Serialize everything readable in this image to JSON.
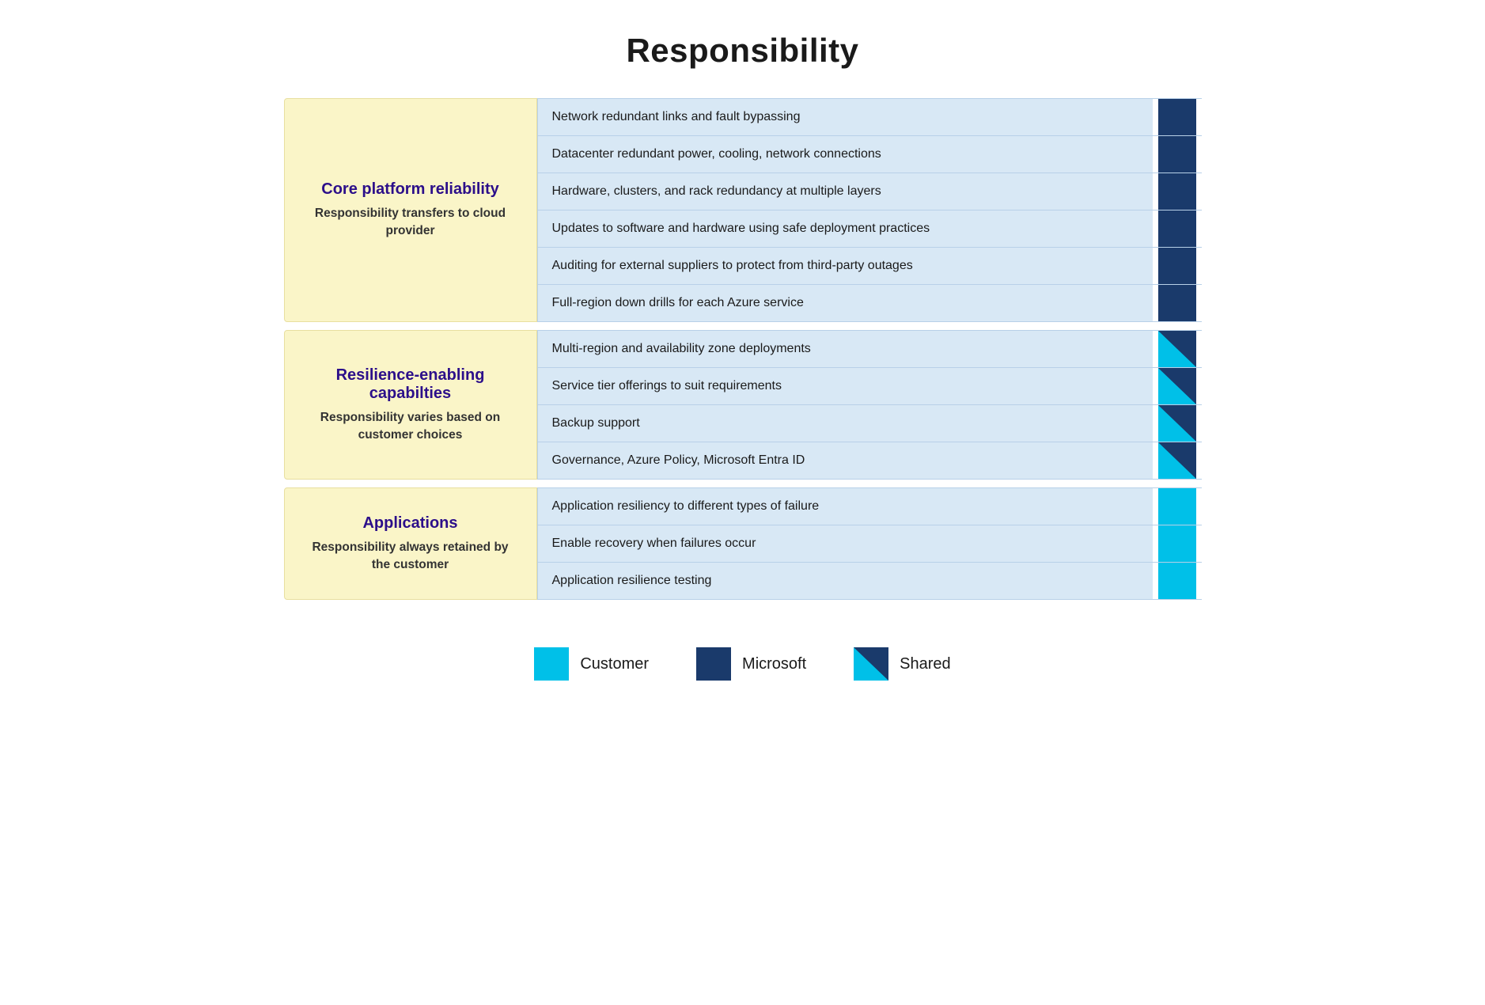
{
  "title": "Responsibility",
  "sections": [
    {
      "id": "core-platform",
      "title": "Core platform reliability",
      "subtitle": "Responsibility transfers\nto cloud provider",
      "items": [
        {
          "text": "Network redundant links and fault bypassing",
          "indicator": "microsoft"
        },
        {
          "text": "Datacenter redundant power, cooling, network connections",
          "indicator": "microsoft"
        },
        {
          "text": "Hardware, clusters, and rack redundancy at multiple layers",
          "indicator": "microsoft"
        },
        {
          "text": "Updates to software and hardware using safe deployment practices",
          "indicator": "microsoft"
        },
        {
          "text": "Auditing for external suppliers to protect from third-party outages",
          "indicator": "microsoft"
        },
        {
          "text": "Full-region down drills for each Azure service",
          "indicator": "microsoft"
        }
      ]
    },
    {
      "id": "resilience-enabling",
      "title": "Resilience-enabling capabilties",
      "subtitle": "Responsibility varies based\non customer choices",
      "items": [
        {
          "text": "Multi-region and availability zone deployments",
          "indicator": "shared"
        },
        {
          "text": "Service tier offerings to suit requirements",
          "indicator": "shared"
        },
        {
          "text": "Backup support",
          "indicator": "shared"
        },
        {
          "text": "Governance, Azure Policy, Microsoft Entra ID",
          "indicator": "shared"
        }
      ]
    },
    {
      "id": "applications",
      "title": "Applications",
      "subtitle": "Responsibility always\nretained by the customer",
      "items": [
        {
          "text": "Application resiliency to different types of failure",
          "indicator": "customer"
        },
        {
          "text": "Enable recovery when failures occur",
          "indicator": "customer"
        },
        {
          "text": "Application resilience testing",
          "indicator": "customer"
        }
      ]
    }
  ],
  "legend": {
    "items": [
      {
        "id": "customer",
        "label": "Customer",
        "type": "customer"
      },
      {
        "id": "microsoft",
        "label": "Microsoft",
        "type": "microsoft"
      },
      {
        "id": "shared",
        "label": "Shared",
        "type": "shared"
      }
    ]
  }
}
